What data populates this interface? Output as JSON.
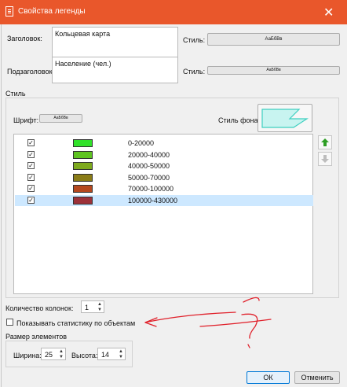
{
  "window": {
    "title": "Свойства легенды",
    "close_glyph": "✕"
  },
  "header": {
    "title_label": "Заголовок:",
    "title_value": "Кольцевая карта",
    "title_style_label": "Стиль:",
    "title_style_button": "АаБбВв",
    "subtitle_label": "Подзаголовок:",
    "subtitle_value": "Население (чел.)",
    "subtitle_style_label": "Стиль:",
    "subtitle_style_button": "АаБбВв"
  },
  "style_group": {
    "label": "Стиль",
    "font_label": "Шрифт:",
    "font_button": "АаБбВв",
    "bg_style_label": "Стиль фона:",
    "bg_colors": {
      "fill": "#c8f4f0",
      "stroke": "#3ecfc0"
    }
  },
  "legend_items": [
    {
      "range": "0-20000",
      "checked": true,
      "color": "#31e22a"
    },
    {
      "range": "20000-40000",
      "checked": true,
      "color": "#5fc421"
    },
    {
      "range": "40000-50000",
      "checked": true,
      "color": "#7eaa1e"
    },
    {
      "range": "50000-70000",
      "checked": true,
      "color": "#8a7c17"
    },
    {
      "range": "70000-100000",
      "checked": true,
      "color": "#b5481f"
    },
    {
      "range": "100000-430000",
      "checked": true,
      "color": "#9c3139",
      "selected": true
    }
  ],
  "side_buttons": {
    "up_icon": "arrow-up-icon",
    "down_icon": "arrow-down-icon",
    "up_color": "#2e9e25"
  },
  "columns": {
    "label": "Количество колонок:",
    "value": "1"
  },
  "stats_checkbox": {
    "label": "Показывать статистику по объектам",
    "checked": false
  },
  "size_group": {
    "label": "Размер элементов",
    "width_label": "Ширина:",
    "width_value": "25",
    "height_label": "Высота:",
    "height_value": "14"
  },
  "buttons": {
    "ok": "ОК",
    "cancel": "Отменить"
  },
  "annotation": {
    "color": "#e0202a",
    "question_mark": "?"
  }
}
